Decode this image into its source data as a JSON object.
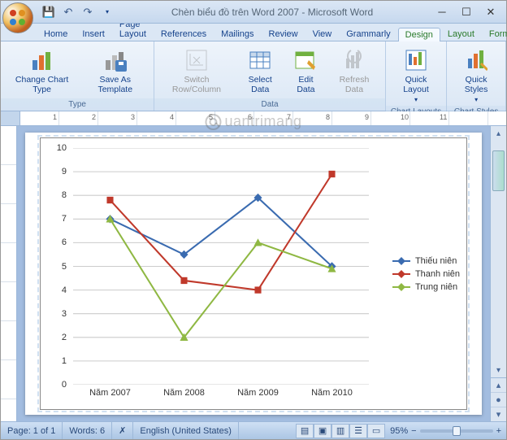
{
  "title": "Chèn biểu đồ trên Word 2007 - Microsoft Word",
  "qat": {
    "save": "💾",
    "undo": "↶",
    "redo": "↷"
  },
  "tabs": [
    "Home",
    "Insert",
    "Page Layout",
    "References",
    "Mailings",
    "Review",
    "View",
    "Grammarly",
    "Design",
    "Layout",
    "Format"
  ],
  "active_tab": "Design",
  "ribbon": {
    "type": {
      "label": "Type",
      "change": "Change Chart Type",
      "saveas": "Save As Template"
    },
    "data": {
      "label": "Data",
      "switch": "Switch Row/Column",
      "select": "Select Data",
      "edit": "Edit Data",
      "refresh": "Refresh Data"
    },
    "layouts": {
      "label": "Chart Layouts",
      "quick": "Quick Layout"
    },
    "styles": {
      "label": "Chart Styles",
      "quick": "Quick Styles"
    }
  },
  "chart_data": {
    "type": "line",
    "categories": [
      "Năm 2007",
      "Năm 2008",
      "Năm 2009",
      "Năm 2010"
    ],
    "series": [
      {
        "name": "Thiếu niên",
        "color": "#3a6bb0",
        "marker": "diamond",
        "values": [
          7.0,
          5.5,
          7.9,
          5.0
        ]
      },
      {
        "name": "Thanh niên",
        "color": "#c0392b",
        "marker": "square",
        "values": [
          7.8,
          4.4,
          4.0,
          8.9
        ]
      },
      {
        "name": "Trung niên",
        "color": "#8fb843",
        "marker": "triangle",
        "values": [
          7.0,
          2.0,
          6.0,
          4.9
        ]
      }
    ],
    "ylim": [
      0,
      10
    ],
    "yticks": [
      0,
      1,
      2,
      3,
      4,
      5,
      6,
      7,
      8,
      9,
      10
    ]
  },
  "status": {
    "page": "Page: 1 of 1",
    "words": "Words: 6",
    "lang": "English (United States)",
    "zoom": "95%"
  },
  "watermark": "uantrimang"
}
